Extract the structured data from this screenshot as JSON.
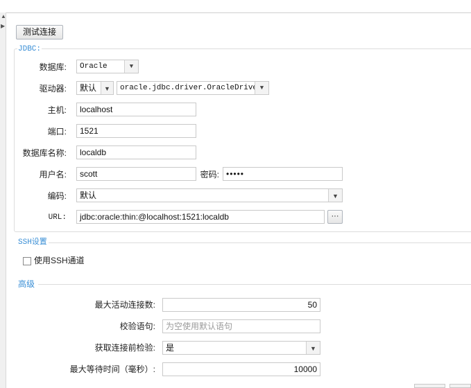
{
  "toolbar": {
    "test_connection_label": "测试连接"
  },
  "jdbc": {
    "legend": "JDBC:",
    "database_label": "数据库:",
    "database_value": "Oracle",
    "driver_label": "驱动器:",
    "driver_mode": "默认",
    "driver_class": "oracle.jdbc.driver.OracleDriver",
    "host_label": "主机:",
    "host_value": "localhost",
    "port_label": "端口:",
    "port_value": "1521",
    "dbname_label": "数据库名称:",
    "dbname_value": "localdb",
    "username_label": "用户名:",
    "username_value": "scott",
    "password_label": "密码:",
    "password_value": "•••••",
    "encoding_label": "编码:",
    "encoding_value": "默认",
    "url_label": "URL:",
    "url_value": "jdbc:oracle:thin:@localhost:1521:localdb",
    "url_more_label": "···"
  },
  "ssh": {
    "legend": "SSH设置",
    "use_ssh_label": "使用SSH通道",
    "use_ssh_checked": false
  },
  "advanced": {
    "legend": "高级",
    "max_active_label": "最大活动连接数:",
    "max_active_value": "50",
    "validation_query_label": "校验语句:",
    "validation_query_placeholder": "为空使用默认语句",
    "test_on_borrow_label": "获取连接前检验:",
    "test_on_borrow_value": "是",
    "max_wait_label": "最大等待时间（毫秒）:",
    "max_wait_value": "10000"
  },
  "colors": {
    "legend": "#3a8fd6",
    "border": "#dcdcdc",
    "input_border": "#c9c9c9"
  },
  "icons": {
    "dropdown": "chevron-down-icon",
    "collapse_up": "triangle-up-icon",
    "collapse_right": "triangle-right-icon"
  }
}
